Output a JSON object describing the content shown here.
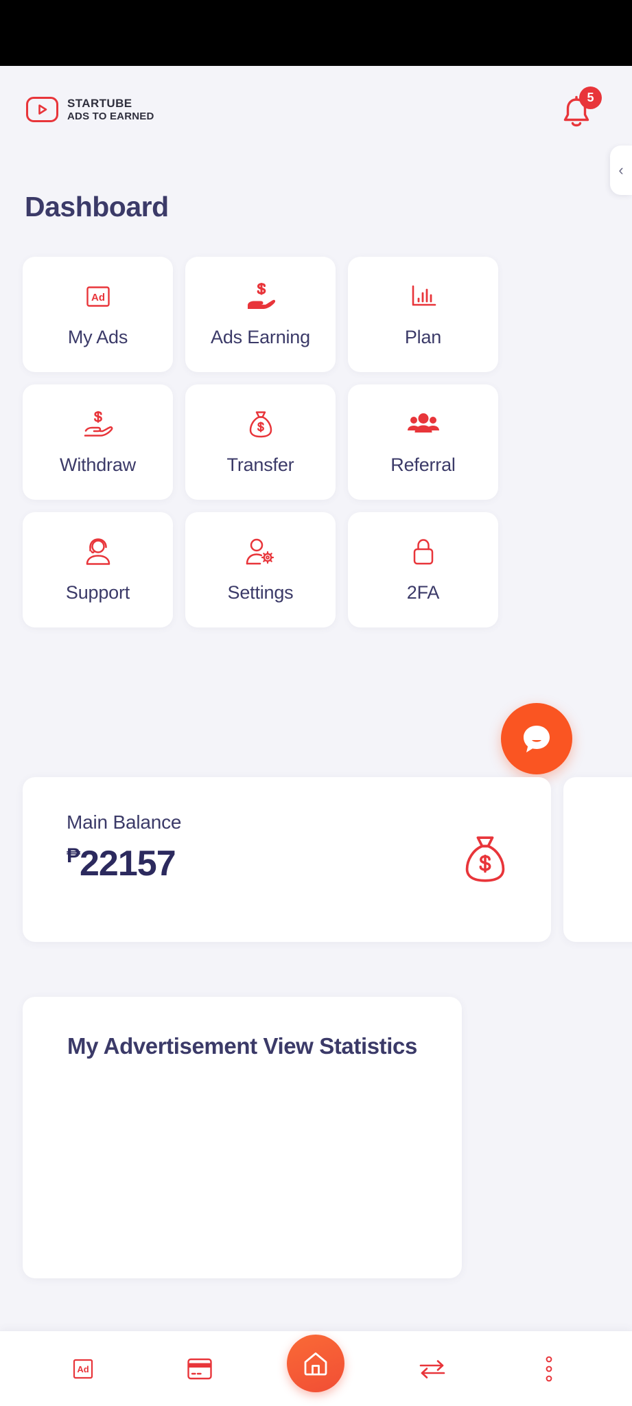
{
  "brand": {
    "name": "STARTUBE",
    "tagline": "ADS TO EARNED",
    "logo_icon": "play-button-icon"
  },
  "header": {
    "notification_icon": "bell-icon",
    "notification_count": "5"
  },
  "page": {
    "title": "Dashboard"
  },
  "drawer": {
    "handle_icon": "chevron-left-icon",
    "handle_glyph": "‹"
  },
  "tiles": [
    {
      "label": "My Ads",
      "icon": "ad-box-icon"
    },
    {
      "label": "Ads Earning",
      "icon": "hand-dollar-filled-icon"
    },
    {
      "label": "Plan",
      "icon": "bar-chart-icon"
    },
    {
      "label": "Withdraw",
      "icon": "hand-dollar-outline-icon"
    },
    {
      "label": "Transfer",
      "icon": "money-bag-icon"
    },
    {
      "label": "Referral",
      "icon": "people-group-icon"
    },
    {
      "label": "Support",
      "icon": "headset-person-icon"
    },
    {
      "label": "Settings",
      "icon": "person-gear-icon"
    },
    {
      "label": "2FA",
      "icon": "lock-icon"
    }
  ],
  "chat": {
    "icon": "chat-bubble-icon"
  },
  "balance": {
    "cards": [
      {
        "label": "Main Balance",
        "currency_symbol": "₱",
        "amount": "22157",
        "icon": "money-bag-icon"
      }
    ]
  },
  "statistics": {
    "title": "My Advertisement View Statistics"
  },
  "bottom_nav": [
    {
      "name": "ads",
      "icon": "ad-box-icon",
      "active": false
    },
    {
      "name": "card",
      "icon": "credit-card-icon",
      "active": false
    },
    {
      "name": "home",
      "icon": "home-icon",
      "active": true
    },
    {
      "name": "transfer",
      "icon": "exchange-arrows-icon",
      "active": false
    },
    {
      "name": "more",
      "icon": "more-vertical-icon",
      "active": false
    }
  ],
  "colors": {
    "brand_red": "#e8353a",
    "accent_orange": "#fa5522",
    "navy": "#3b3a68",
    "page_bg": "#f4f4f9",
    "card_bg": "#ffffff"
  },
  "chart_data": {
    "type": "line",
    "title": "My Advertisement View Statistics",
    "categories": [],
    "values": [],
    "xlabel": "",
    "ylabel": "",
    "note": "plot area empty / not yet rendered"
  }
}
